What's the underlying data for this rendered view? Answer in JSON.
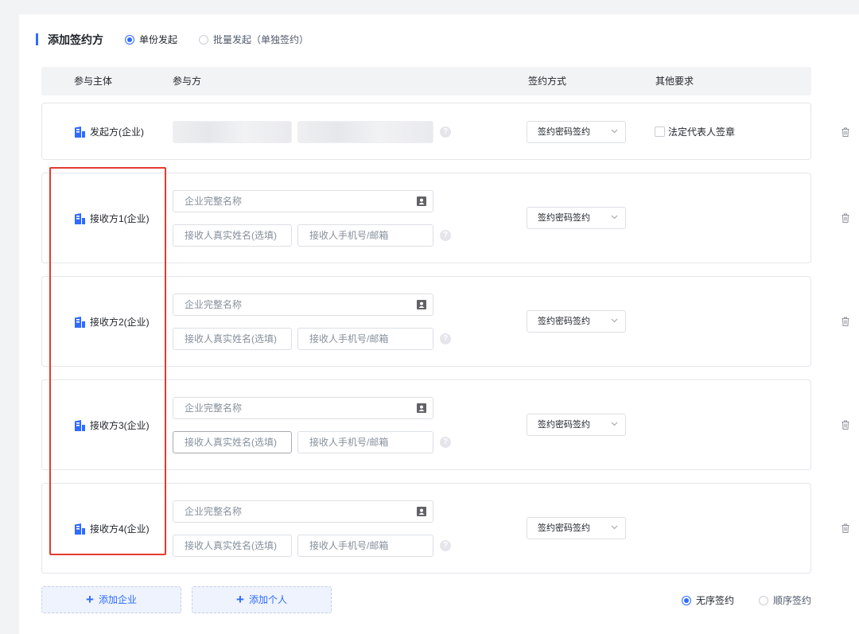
{
  "section": {
    "title": "添加签约方",
    "modes": [
      {
        "label": "单份发起",
        "selected": true
      },
      {
        "label": "批量发起（单独签约）",
        "selected": false
      }
    ]
  },
  "columns": [
    "参与主体",
    "参与方",
    "签约方式",
    "其他要求"
  ],
  "rows": [
    {
      "entity": "发起方(企业)",
      "sign_method": "签约密码签约",
      "other_requirement": "法定代表人签章"
    },
    {
      "entity": "接收方1(企业)",
      "company_placeholder": "企业完整名称",
      "name_placeholder": "接收人真实姓名(选填)",
      "contact_placeholder": "接收人手机号/邮箱",
      "sign_method": "签约密码签约"
    },
    {
      "entity": "接收方2(企业)",
      "company_placeholder": "企业完整名称",
      "name_placeholder": "接收人真实姓名(选填)",
      "contact_placeholder": "接收人手机号/邮箱",
      "sign_method": "签约密码签约"
    },
    {
      "entity": "接收方3(企业)",
      "company_placeholder": "企业完整名称",
      "name_placeholder": "接收人真实姓名(选填)",
      "contact_placeholder": "接收人手机号/邮箱",
      "sign_method": "签约密码签约"
    },
    {
      "entity": "接收方4(企业)",
      "company_placeholder": "企业完整名称",
      "name_placeholder": "接收人真实姓名(选填)",
      "contact_placeholder": "接收人手机号/邮箱",
      "sign_method": "签约密码签约"
    }
  ],
  "help_glyph": "?",
  "actions": {
    "add_company": "添加企业",
    "add_person": "添加个人",
    "plus_glyph": "+"
  },
  "order": [
    {
      "label": "无序签约",
      "selected": true
    },
    {
      "label": "顺序签约",
      "selected": false
    }
  ],
  "colors": {
    "accent": "#2f6bff",
    "highlight": "#e23b2e"
  },
  "icons": {
    "entity": "building-icon",
    "company_field": "contact-card-icon",
    "help": "help-icon",
    "dropdown": "chevron-down-icon",
    "delete": "trash-icon"
  }
}
